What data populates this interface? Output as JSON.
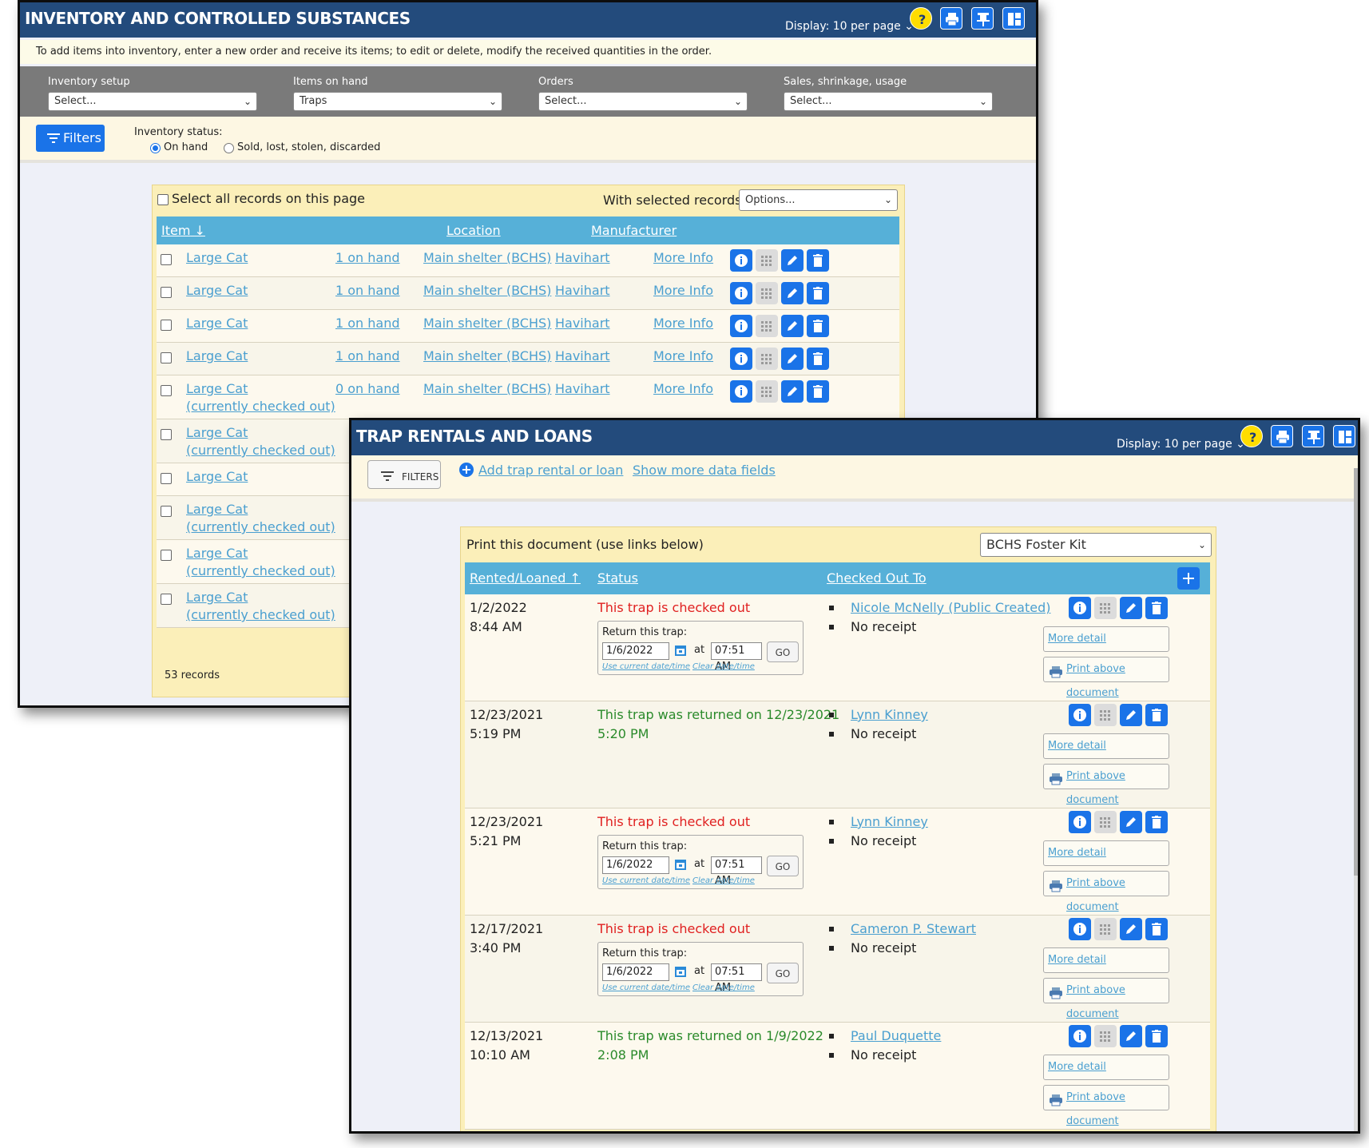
{
  "inventory": {
    "title": "INVENTORY AND CONTROLLED SUBSTANCES",
    "display": "Display: 10 per page",
    "notice": "To add items into inventory, enter a new order and receive its items; to edit or delete, modify the received quantities in the order.",
    "dropdowns": [
      {
        "label": "Inventory setup",
        "value": "Select..."
      },
      {
        "label": "Items on hand",
        "value": "Traps"
      },
      {
        "label": "Orders",
        "value": "Select..."
      },
      {
        "label": "Sales, shrinkage, usage",
        "value": "Select..."
      }
    ],
    "filters_label": "Filters",
    "status_label": "Inventory status:",
    "status_options": [
      "On hand",
      "Sold, lost, stolen, discarded"
    ],
    "select_all": "Select all records on this page",
    "with_selected": "With selected records:",
    "options_value": "Options...",
    "columns": {
      "item": "Item",
      "location": "Location",
      "manufacturer": "Manufacturer"
    },
    "rows": [
      {
        "item": "Large Cat",
        "sub": "",
        "qty": "1 on hand",
        "location": "Main shelter (BCHS)",
        "manufacturer": "Havihart",
        "more": "More Info"
      },
      {
        "item": "Large Cat",
        "sub": "",
        "qty": "1 on hand",
        "location": "Main shelter (BCHS)",
        "manufacturer": "Havihart",
        "more": "More Info"
      },
      {
        "item": "Large Cat",
        "sub": "",
        "qty": "1 on hand",
        "location": "Main shelter (BCHS)",
        "manufacturer": "Havihart",
        "more": "More Info"
      },
      {
        "item": "Large Cat",
        "sub": "",
        "qty": "1 on hand",
        "location": "Main shelter (BCHS)",
        "manufacturer": "Havihart",
        "more": "More Info"
      },
      {
        "item": "Large Cat",
        "sub": "(currently checked out)",
        "qty": "0 on hand",
        "location": "Main shelter (BCHS)",
        "manufacturer": "Havihart",
        "more": "More Info"
      },
      {
        "item": "Large Cat",
        "sub": "(currently checked out)"
      },
      {
        "item": "Large Cat",
        "sub": ""
      },
      {
        "item": "Large Cat",
        "sub": "(currently checked out)"
      },
      {
        "item": "Large Cat",
        "sub": "(currently checked out)"
      },
      {
        "item": "Large Cat",
        "sub": "(currently checked out)"
      }
    ],
    "record_count": "53 records"
  },
  "trap": {
    "title": "TRAP RENTALS AND LOANS",
    "display": "Display: 10 per page",
    "filters_label": "FILTERS",
    "add_link": "Add trap rental or loan",
    "more_fields": "Show more data fields",
    "print_label": "Print this document (use links below)",
    "print_doc": "BCHS Foster Kit",
    "columns": {
      "rented": "Rented/Loaned",
      "status": "Status",
      "checked_out_to": "Checked Out To"
    },
    "return_label": "Return this trap:",
    "at_label": "at",
    "go_label": "GO",
    "use_current": "Use current date/time",
    "clear": "Clear date/time",
    "more_detail": "More detail",
    "print_above": "Print above document",
    "rows": [
      {
        "date": "1/2/2022",
        "time": "8:44 AM",
        "status1": "This trap is checked out",
        "status2": "",
        "checked_out": true,
        "return_date": "1/6/2022",
        "return_time": "07:51 AM",
        "person": "Nicole McNelly (Public Created)",
        "receipt": "No receipt"
      },
      {
        "date": "12/23/2021",
        "time": "5:19 PM",
        "status1": "This trap was returned on 12/23/2021",
        "status2": "5:20 PM",
        "checked_out": false,
        "return_date": "",
        "return_time": "",
        "person": "Lynn Kinney",
        "receipt": "No receipt"
      },
      {
        "date": "12/23/2021",
        "time": "5:21 PM",
        "status1": "This trap is checked out",
        "status2": "",
        "checked_out": true,
        "return_date": "1/6/2022",
        "return_time": "07:51 AM",
        "person": "Lynn Kinney",
        "receipt": "No receipt"
      },
      {
        "date": "12/17/2021",
        "time": "3:40 PM",
        "status1": "This trap is checked out",
        "status2": "",
        "checked_out": true,
        "return_date": "1/6/2022",
        "return_time": "07:51 AM",
        "person": "Cameron P. Stewart",
        "receipt": "No receipt"
      },
      {
        "date": "12/13/2021",
        "time": "10:10 AM",
        "status1": "This trap was returned on 1/9/2022",
        "status2": "2:08 PM",
        "checked_out": false,
        "return_date": "",
        "return_time": "",
        "person": "Paul Duquette",
        "receipt": "No receipt"
      }
    ]
  },
  "colors": {
    "header": "#234b7c",
    "accent": "#1a73e8",
    "table_head": "#56b0d8",
    "panel": "#fbefb9",
    "red": "#e02020",
    "green": "#2a8a2a",
    "link": "#4a9fd0"
  }
}
